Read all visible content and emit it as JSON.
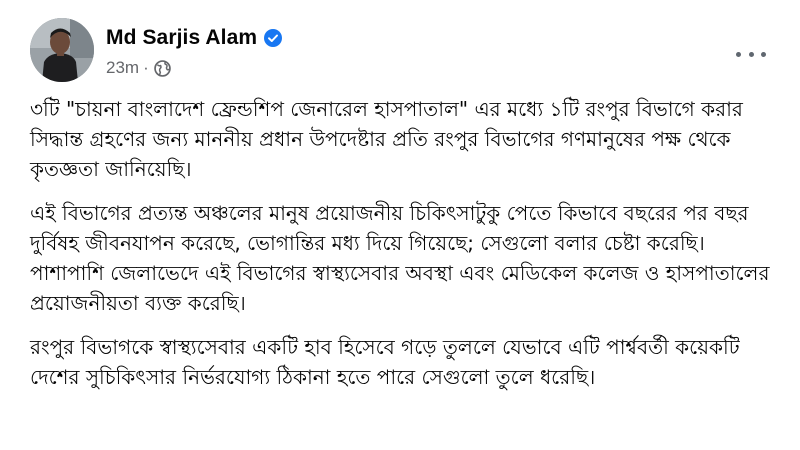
{
  "post": {
    "author": {
      "name": "Md Sarjis Alam",
      "verified": true,
      "avatar_icon": "profile-photo-avatar"
    },
    "meta": {
      "timestamp": "23m",
      "separator": "·",
      "privacy_icon": "globe-icon"
    },
    "more_options_icon": "more-horizontal-icon",
    "paragraphs": [
      "৩টি \"চায়না বাংলাদেশ ফ্রেন্ডশিপ জেনারেল হাসপাতাল\" এর মধ্যে ১টি রংপুর বিভাগে করার সিদ্ধান্ত গ্রহণের জন্য মাননীয় প্রধান উপদেষ্টার প্রতি রংপুর বিভাগের গণমানুষের পক্ষ থেকে কৃতজ্ঞতা জানিয়েছি।",
      "এই বিভাগের প্রত্যন্ত অঞ্চলের মানুষ প্রয়োজনীয় চিকিৎসাটুকু পেতে কিভাবে বছরের পর বছর দুর্বিষহ জীবনযাপন করেছে, ভোগান্তির মধ্য দিয়ে গিয়েছে; সেগুলো বলার চেষ্টা করেছি। পাশাপাশি জেলাভেদে এই বিভাগের স্বাস্থ্যসেবার অবস্থা এবং মেডিকেল কলেজ ও হাসপাতালের প্রয়োজনীয়তা ব্যক্ত করেছি।",
      "রংপুর বিভাগকে স্বাস্থ্যসেবার একটি হাব হিসেবে গড়ে তুললে যেভাবে এটি পার্শ্ববর্তী কয়েকটি দেশের সুচিকিৎসার নির্ভরযোগ্য ঠিকানা হতে পারে সেগুলো তুলে ধরেছি।"
    ]
  },
  "colors": {
    "verified_badge": "#1877f2",
    "secondary_text": "#65676b",
    "primary_text": "#050505",
    "background": "#ffffff"
  }
}
